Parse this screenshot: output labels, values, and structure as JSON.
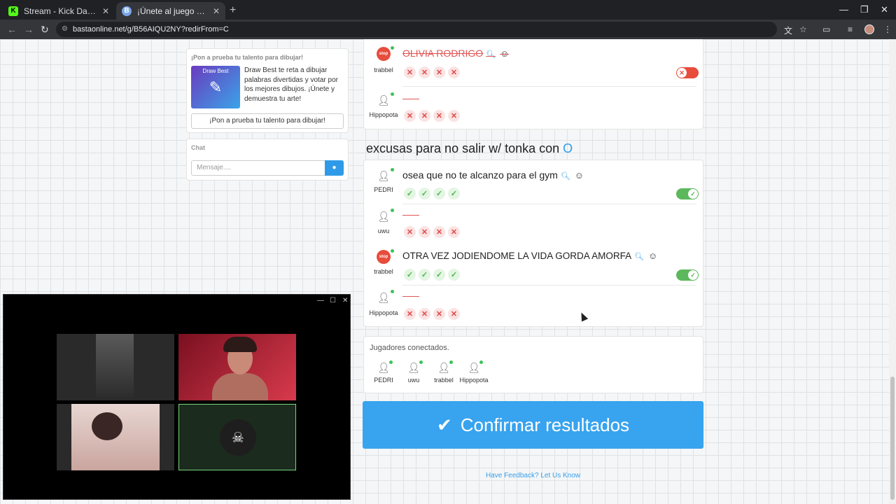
{
  "browser": {
    "tabs": [
      {
        "label": "Stream - Kick Dashboard",
        "favicon": "K"
      },
      {
        "label": "¡Únete al juego Basta!",
        "favicon": "B"
      }
    ],
    "url": "bastaonline.net/g/B56AIQU2NY?redirFrom=C"
  },
  "sidebar": {
    "promo": {
      "title": "¡Pon a prueba tu talento para dibujar!",
      "image_label": "Draw Best",
      "text": "Draw Best te reta a dibujar palabras divertidas y votar por los mejores dibujos. ¡Únete y demuestra tu arte!",
      "button": "¡Pon a prueba tu talento para dibujar!"
    },
    "chat": {
      "title": "Chat",
      "placeholder": "Mensaje...."
    }
  },
  "prev_category": {
    "rows": [
      {
        "player": "trabbel",
        "answer": "OLIVIA RODRIGO",
        "struck": true,
        "votes": [
          "no",
          "no",
          "no",
          "no"
        ],
        "toggle": "off"
      },
      {
        "player": "Hippopota",
        "answer": "",
        "votes": [
          "no",
          "no",
          "no",
          "no"
        ]
      }
    ]
  },
  "category": {
    "title": "excusas para no salir w/ tonka con",
    "letter": "O",
    "rows": [
      {
        "player": "PEDRI",
        "answer": "osea que no te alcanzo para el gym",
        "votes": [
          "yes",
          "yes",
          "yes",
          "yes"
        ],
        "toggle": "on"
      },
      {
        "player": "uwu",
        "answer": "",
        "votes": [
          "no",
          "no",
          "no",
          "no"
        ]
      },
      {
        "player": "trabbel",
        "answer": "OTRA VEZ JODIENDOME LA VIDA GORDA AMORFA",
        "votes": [
          "yes",
          "yes",
          "yes",
          "yes"
        ],
        "toggle": "on"
      },
      {
        "player": "Hippopota",
        "answer": "",
        "votes": [
          "no",
          "no",
          "no",
          "no"
        ]
      }
    ]
  },
  "connected": {
    "title": "Jugadores conectados.",
    "players": [
      "PEDRI",
      "uwu",
      "trabbel",
      "Hippopota"
    ]
  },
  "confirm_label": "Confirmar resultados",
  "feedback_link": "Have Feedback? Let Us Know",
  "badge_text": "stop",
  "colors": {
    "accent": "#38a3ee",
    "ok": "#5cb85c",
    "bad": "#e74c3c"
  }
}
